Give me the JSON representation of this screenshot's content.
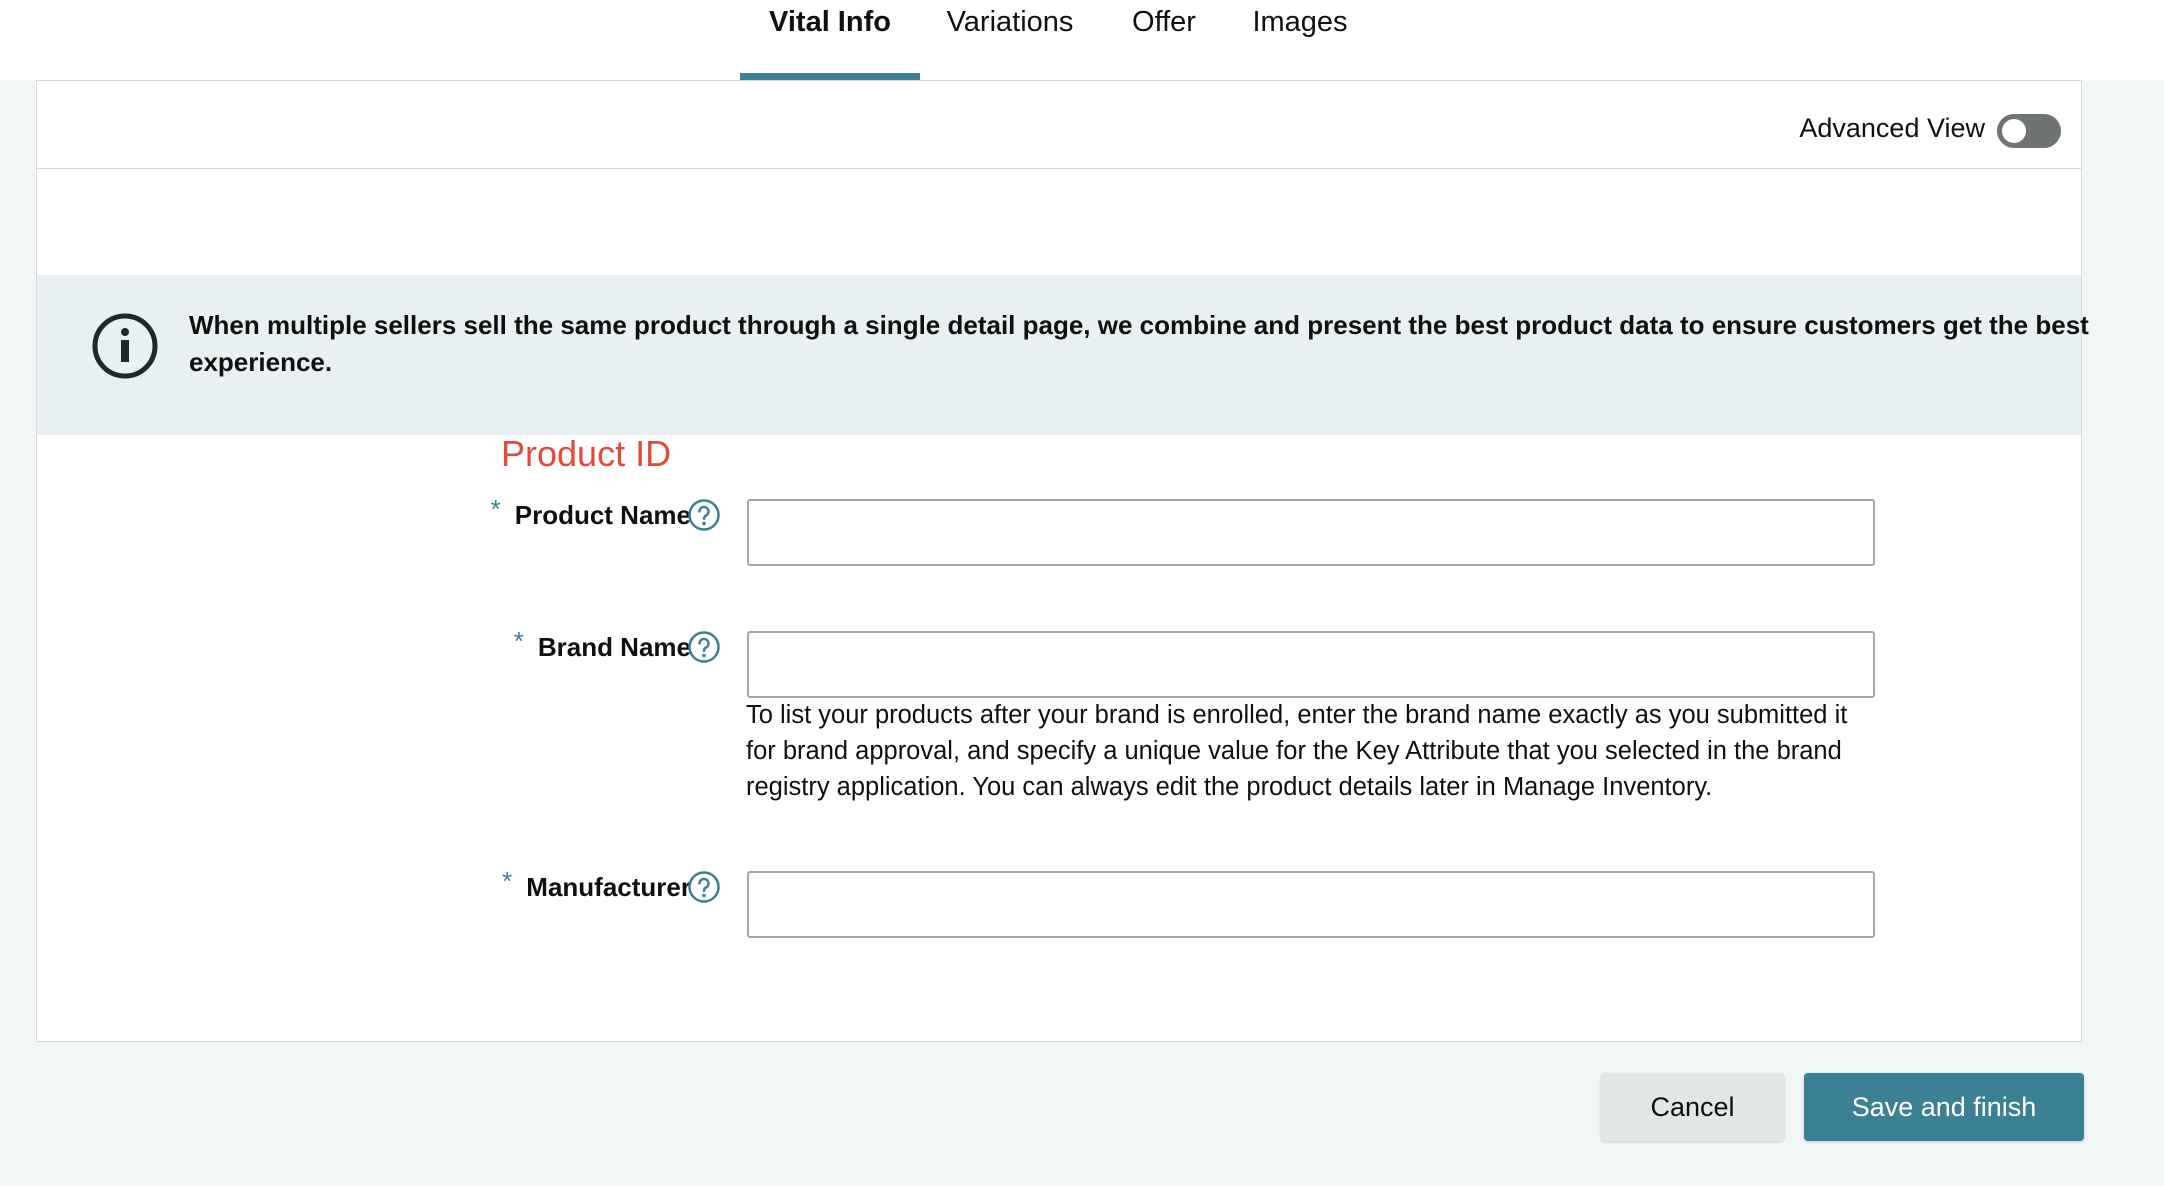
{
  "tabs": [
    {
      "label": "Vital Info",
      "active": true
    },
    {
      "label": "Variations",
      "active": false
    },
    {
      "label": "Offer",
      "active": false
    },
    {
      "label": "Images",
      "active": false
    }
  ],
  "header": {
    "advanced_view_label": "Advanced View",
    "advanced_view_on": false
  },
  "info": {
    "icon": "info-circle-icon",
    "text": "When multiple sellers sell the same product through a single detail page, we combine and present the best product data to ensure customers get the best experience."
  },
  "section": {
    "title": "Product ID"
  },
  "fields": [
    {
      "label": "Product Name",
      "required_mark": "*",
      "value": ""
    },
    {
      "label": "Brand Name",
      "required_mark": "*",
      "value": "",
      "help_text": "To list your products after your brand is enrolled, enter the brand name exactly as you submitted it for brand approval, and specify a unique value for the Key Attribute that you selected in the brand registry application. You can always edit the product details later in Manage Inventory."
    },
    {
      "label": "Manufacturer",
      "required_mark": "*",
      "value": ""
    }
  ],
  "buttons": {
    "cancel": "Cancel",
    "save": "Save and finish"
  },
  "colors": {
    "accent": "#3b8093",
    "section_title": "#e04c3c",
    "info_bg": "#e8f0f1"
  }
}
